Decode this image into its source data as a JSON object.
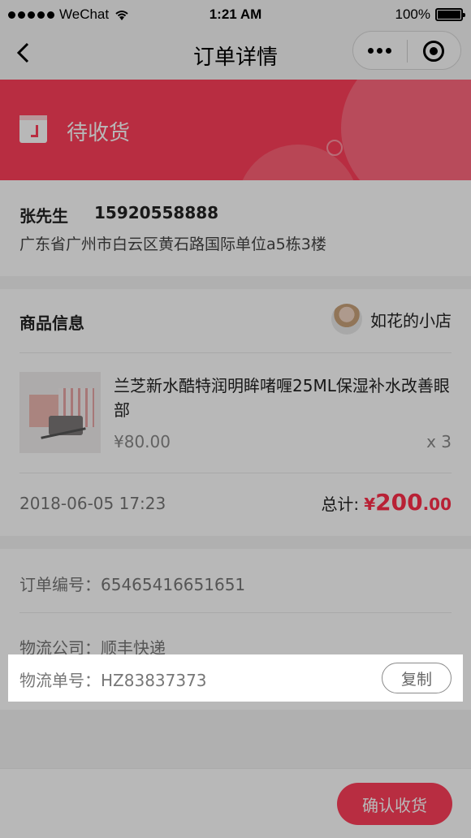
{
  "status_bar": {
    "carrier": "WeChat",
    "time": "1:21 AM",
    "battery": "100%"
  },
  "nav": {
    "title": "订单详情"
  },
  "order_status": {
    "text": "待收货"
  },
  "address": {
    "name": "张先生",
    "phone": "15920558888",
    "detail": "广东省广州市白云区黄石路国际单位a5栋3楼"
  },
  "goods": {
    "section_title": "商品信息",
    "shop_name": "如花的小店",
    "item": {
      "name": "兰芝新水酷特润明眸啫喱25ML保湿补水改善眼部",
      "price": "¥80.00",
      "qty": "x 3"
    },
    "order_time": "2018-06-05 17:23",
    "total_label": "总计:",
    "total_currency": "¥",
    "total_int": "200",
    "total_dec": ".00"
  },
  "order_info": {
    "order_no": "订单编号：65465416651651",
    "logistics_company": "物流公司：顺丰快递",
    "tracking_no": "物流单号：HZ83837373",
    "copy_label": "复制"
  },
  "bottom": {
    "confirm_label": "确认收货"
  }
}
